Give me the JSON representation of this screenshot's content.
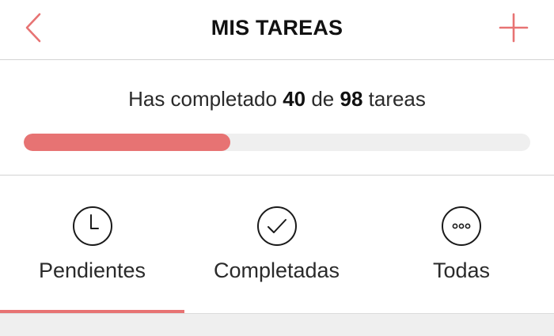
{
  "header": {
    "title": "MIS TAREAS",
    "back_icon": "chevron-left-icon",
    "add_icon": "plus-icon",
    "accent_color": "#e77373"
  },
  "progress": {
    "prefix": "Has completado ",
    "completed": "40",
    "middle": " de ",
    "total": "98",
    "suffix": " tareas",
    "fraction": 0.408
  },
  "tabs": [
    {
      "label": "Pendientes",
      "icon": "clock-icon",
      "selected": true
    },
    {
      "label": "Completadas",
      "icon": "check-circle-icon",
      "selected": false
    },
    {
      "label": "Todas",
      "icon": "more-circle-icon",
      "selected": false
    }
  ]
}
